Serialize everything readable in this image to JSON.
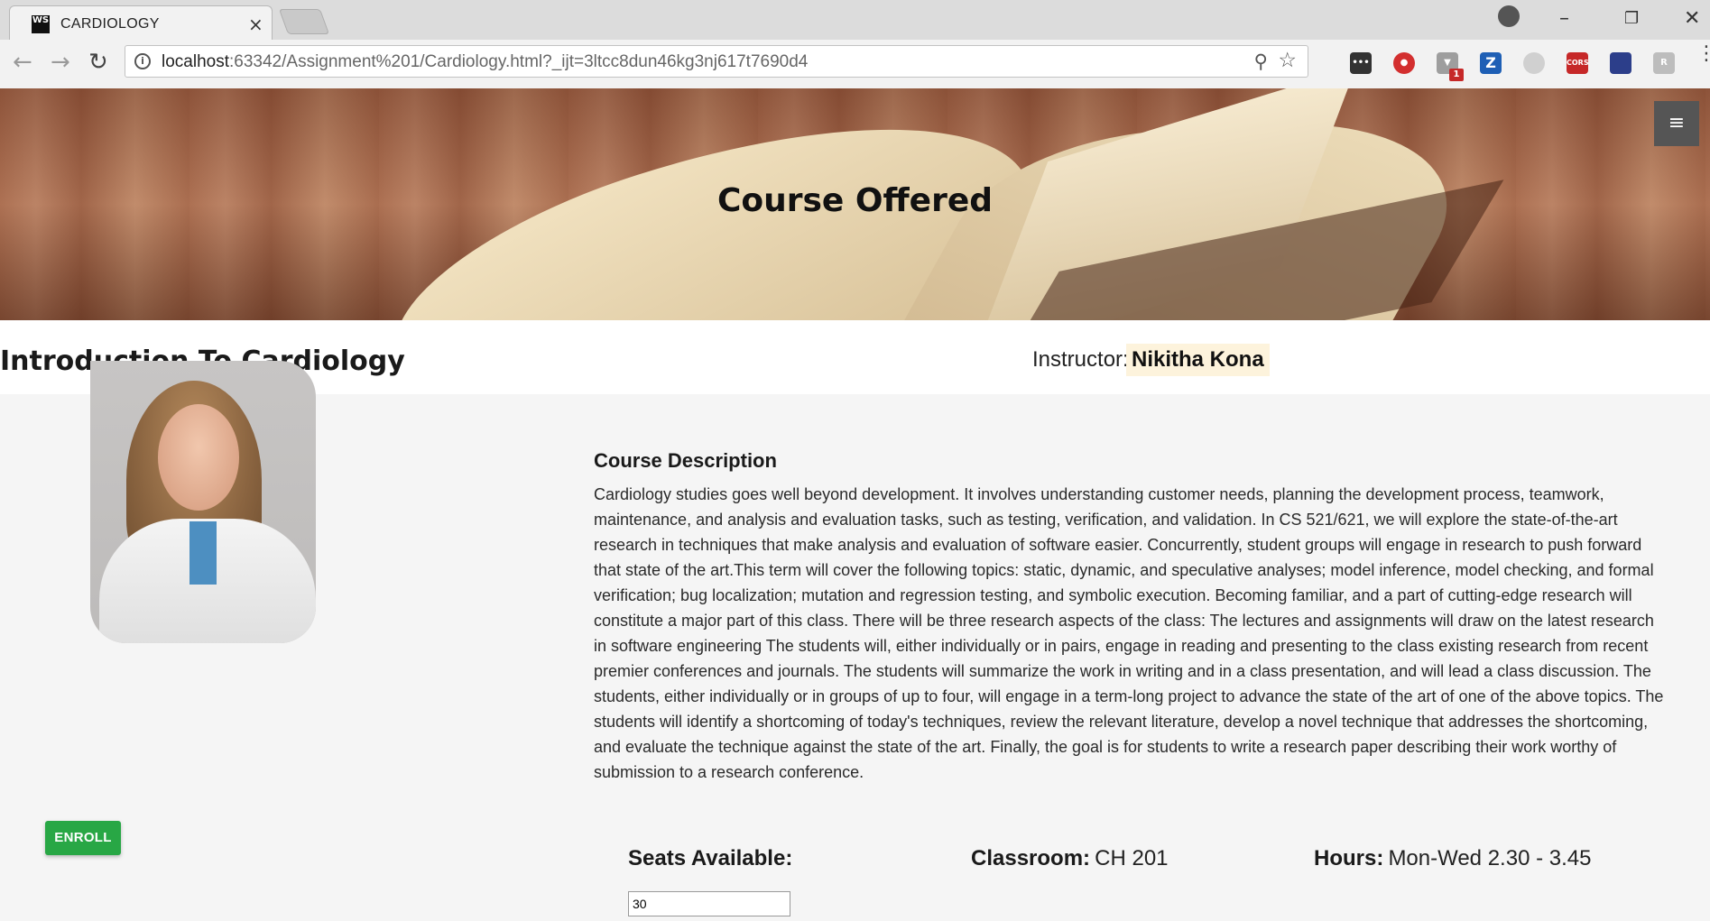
{
  "browser": {
    "tab_title": "CARDIOLOGY",
    "tab_favicon": "WS",
    "url_host": "localhost",
    "url_rest": ":63342/Assignment%201/Cardiology.html?_ijt=3ltcc8dun46kg3nj617t7690d4",
    "extension_badge": "1",
    "extension_cors_label": "CORS"
  },
  "hero": {
    "title": "Course Offered",
    "menu_icon": "≡"
  },
  "course": {
    "title": "Introduction To Cardiology",
    "instructor_label": "Instructor:",
    "instructor_name": "Nikitha Kona"
  },
  "description": {
    "heading": "Course Description",
    "body": "Cardiology studies goes well beyond development. It involves understanding customer needs, planning the development process, teamwork, maintenance, and analysis and evaluation tasks, such as testing, verification, and validation. In CS 521/621, we will explore the state-of-the-art research in techniques that make analysis and evaluation of software easier. Concurrently, student groups will engage in research to push forward that state of the art.This term will cover the following topics: static, dynamic, and speculative analyses; model inference, model checking, and formal verification; bug localization; mutation and regression testing, and symbolic execution. Becoming familiar, and a part of cutting-edge research will constitute a major part of this class. There will be three research aspects of the class: The lectures and assignments will draw on the latest research in software engineering The students will, either individually or in pairs, engage in reading and presenting to the class existing research from recent premier conferences and journals. The students will summarize the work in writing and in a class presentation, and will lead a class discussion. The students, either individually or in groups of up to four, will engage in a term-long project to advance the state of the art of one of the above topics. The students will identify a shortcoming of today's techniques, review the relevant literature, develop a novel technique that addresses the shortcoming, and evaluate the technique against the state of the art. Finally, the goal is for students to write a research paper describing their work worthy of submission to a research conference."
  },
  "actions": {
    "enroll_label": "ENROLL"
  },
  "details": {
    "seats_label": "Seats Available:",
    "seats_value": "30",
    "classroom_label": "Classroom:",
    "classroom_value": "CH 201",
    "hours_label": "Hours:",
    "hours_value": "Mon-Wed 2.30 - 3.45"
  },
  "colors": {
    "enroll_button": "#28a745",
    "instructor_highlight": "#fdf3dc",
    "menu_button": "#555555"
  },
  "icons": [
    "info-icon",
    "zoom-icon",
    "star-icon",
    "back-arrow-icon",
    "forward-arrow-icon",
    "reload-icon",
    "close-icon",
    "hamburger-menu-icon",
    "profile-icon"
  ]
}
